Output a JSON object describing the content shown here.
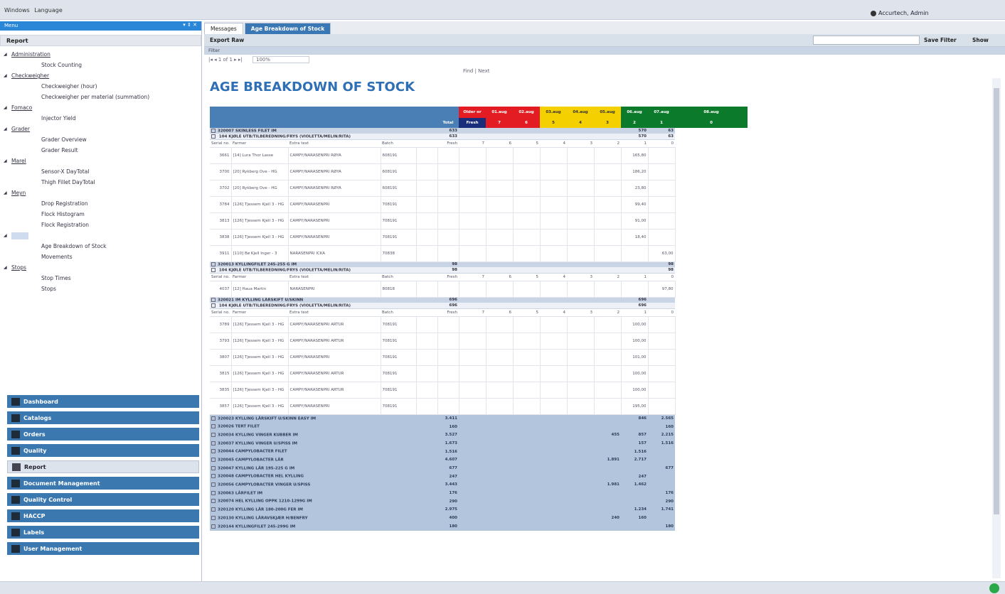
{
  "titlebar": {
    "menus": [
      "Windows",
      "Language"
    ],
    "user": "Accurtech, Admin"
  },
  "leftpanel": {
    "menu_title": "Menu",
    "menu_controls": "▾ ⇕ ✕",
    "report_header": "Report",
    "tree": [
      {
        "type": "group",
        "label": "Administration"
      },
      {
        "type": "leaf",
        "label": "Stock Counting"
      },
      {
        "type": "group",
        "label": "Checkweigher"
      },
      {
        "type": "leaf",
        "label": "Checkweigher (hour)"
      },
      {
        "type": "leaf",
        "label": "Checkweigher per material (summation)"
      },
      {
        "type": "group",
        "label": "Fomaco"
      },
      {
        "type": "leaf",
        "label": "Injector Yield"
      },
      {
        "type": "group",
        "label": "Grader"
      },
      {
        "type": "leaf",
        "label": "Grader Overview"
      },
      {
        "type": "leaf",
        "label": "Grader Result"
      },
      {
        "type": "group",
        "label": "Marel"
      },
      {
        "type": "leaf",
        "label": "Sensor-X DayTotal"
      },
      {
        "type": "leaf",
        "label": "Thigh Fillet DayTotal"
      },
      {
        "type": "group",
        "label": "Meyn"
      },
      {
        "type": "leaf",
        "label": "Drop Registration"
      },
      {
        "type": "leaf",
        "label": "Flock Histogram"
      },
      {
        "type": "leaf",
        "label": "Flock Registration"
      },
      {
        "type": "group",
        "label": "",
        "selected": true
      },
      {
        "type": "leaf",
        "label": "Age Breakdown of Stock"
      },
      {
        "type": "leaf",
        "label": "Movements"
      },
      {
        "type": "group",
        "label": "Stops"
      },
      {
        "type": "leaf",
        "label": "Stop Times"
      },
      {
        "type": "leaf",
        "label": "Stops"
      }
    ],
    "nav_buttons": [
      "Dashboard",
      "Catalogs",
      "Orders",
      "Quality",
      "Report",
      "Document Management",
      "Quality Control",
      "HACCP",
      "Labels",
      "User Management"
    ]
  },
  "rightpanel": {
    "tabs": [
      "Messages",
      "Age Breakdown of Stock"
    ],
    "toolbar": {
      "export": "Export Raw",
      "save_filter": "Save Filter",
      "show": "Show"
    },
    "filter_label": "Filter",
    "report_tools": {
      "nav": "|◂ ◂ 1  of 1 ▸ ▸|",
      "zoom": "100%",
      "find": "Find | Next"
    },
    "report_title": "AGE BREAKDOWN OF STOCK",
    "columns": {
      "total": "Total",
      "older": "Older or",
      "fresh": "Fresh",
      "dates": [
        "01.aug",
        "02.aug",
        "03.aug",
        "04.aug",
        "05.aug",
        "06.aug",
        "07.aug",
        "08.aug"
      ],
      "days": [
        "7",
        "6",
        "5",
        "4",
        "3",
        "2",
        "1",
        "0"
      ],
      "date_colors": [
        "red",
        "red",
        "ylw",
        "ylw",
        "ylw",
        "grn",
        "grn",
        "grn"
      ]
    },
    "subheaders": [
      "Serial no.",
      "Farmer",
      "Extra text",
      "Batch",
      "Fresh",
      "7",
      "6",
      "5",
      "4",
      "3",
      "2",
      "1",
      "0"
    ],
    "groups": [
      {
        "code": "320007",
        "name": "SKINLESS FILET IM",
        "total": "633",
        "d1": "570",
        "d0": "63",
        "product": "104 KJØLE UTB/TILBEREDNING/FRYS (VIOLETTA/MELIN/RITA)",
        "ptotal": "633",
        "pd1": "570",
        "pd0": "63",
        "rows": [
          {
            "serial": "3661",
            "farmer": "[14] Lura Thor Lasse",
            "extra": "CAMPY/NARASENPRI RØYA",
            "batch": "608191",
            "d1": "165,80",
            "d0": ""
          },
          {
            "serial": "3700",
            "farmer": "[20] Rykberg Ove - HG",
            "extra": "CAMPY/NARASENPRI RØYA",
            "batch": "608191",
            "d1": "186,20",
            "d0": ""
          },
          {
            "serial": "3702",
            "farmer": "[20] Rykberg Ove - HG",
            "extra": "CAMPY/NARASENPRI RØYA",
            "batch": "608191",
            "d1": "23,80",
            "d0": ""
          },
          {
            "serial": "3784",
            "farmer": "[126] Tjessem Kjell 3 - HG",
            "extra": "CAMPY/NARASENPRI",
            "batch": "708191",
            "d1": "99,40",
            "d0": ""
          },
          {
            "serial": "3813",
            "farmer": "[126] Tjessem Kjell 3 - HG",
            "extra": "CAMPY/NARASENPRI",
            "batch": "708191",
            "d1": "91,00",
            "d0": ""
          },
          {
            "serial": "3838",
            "farmer": "[126] Tjessem Kjell 3 - HG",
            "extra": "CAMPY/NARASENPRI",
            "batch": "708191",
            "d1": "18,40",
            "d0": ""
          },
          {
            "serial": "3911",
            "farmer": "[110] Bø Kjell Inger - 3",
            "extra": "NARASENPRI ICKA",
            "batch": "70838",
            "d1": "",
            "d0": "63,00"
          }
        ]
      },
      {
        "code": "320013",
        "name": "KYLLINGFILET 245-255 G IM",
        "total": "98",
        "d1": "",
        "d0": "98",
        "product": "104 KJØLE UTB/TILBEREDNING/FRYS (VIOLETTA/MELIN/RITA)",
        "ptotal": "98",
        "pd1": "",
        "pd0": "98",
        "rows": [
          {
            "serial": "4037",
            "farmer": "[12] Haua Martin",
            "extra": "NARASENPRI",
            "batch": "80818",
            "d1": "",
            "d0": "97,80"
          }
        ]
      },
      {
        "code": "320021",
        "name": "IM KYLLING LÅRSKIFT U/SKINN",
        "total": "696",
        "d1": "696",
        "d0": "",
        "product": "104 KJØLE UTB/TILBEREDNING/FRYS (VIOLETTA/MELIN/RITA)",
        "ptotal": "696",
        "pd1": "696",
        "pd0": "",
        "rows": [
          {
            "serial": "3789",
            "farmer": "[126] Tjessem Kjell 3 - HG",
            "extra": "CAMPY/NARASENPRI ARTUR",
            "batch": "708191",
            "d1": "100,00",
            "d0": ""
          },
          {
            "serial": "3793",
            "farmer": "[126] Tjessem Kjell 3 - HG",
            "extra": "CAMPY/NARASENPRI ARTUR",
            "batch": "708191",
            "d1": "100,00",
            "d0": ""
          },
          {
            "serial": "3807",
            "farmer": "[126] Tjessem Kjell 3 - HG",
            "extra": "CAMPY/NARASENPRI",
            "batch": "708191",
            "d1": "101,00",
            "d0": ""
          },
          {
            "serial": "3815",
            "farmer": "[126] Tjessem Kjell 3 - HG",
            "extra": "CAMPY/NARASENPRI ARTUR",
            "batch": "708191",
            "d1": "100,00",
            "d0": ""
          },
          {
            "serial": "3835",
            "farmer": "[126] Tjessem Kjell 3 - HG",
            "extra": "CAMPY/NARASENPRI ARTUR",
            "batch": "708191",
            "d1": "100,00",
            "d0": ""
          },
          {
            "serial": "3857",
            "farmer": "[126] Tjessem Kjell 3 - HG",
            "extra": "CAMPY/NARASENPRI",
            "batch": "708191",
            "d1": "195,00",
            "d0": ""
          }
        ]
      }
    ],
    "summary_rows": [
      {
        "code": "320023",
        "name": "KYLLING LÅRSKIFT U/SKINN EASY IM",
        "total": "3.411",
        "d2": "",
        "d1": "846",
        "d0": "2.565"
      },
      {
        "code": "320026",
        "name": "TERT FILET",
        "total": "160",
        "d2": "",
        "d1": "",
        "d0": "160"
      },
      {
        "code": "320034",
        "name": "KYLLING VINGER KUBBER IM",
        "total": "3.527",
        "d2": "455",
        "d1": "857",
        "d0": "2.215"
      },
      {
        "code": "320037",
        "name": "KYLLING VINGER U/SPISS IM",
        "total": "1.673",
        "d2": "",
        "d1": "157",
        "d0": "1.516"
      },
      {
        "code": "320044",
        "name": "CAMPYLOBACTER FILET",
        "total": "1.516",
        "d2": "",
        "d1": "1.516",
        "d0": ""
      },
      {
        "code": "320045",
        "name": "CAMPYLOBACTER LÅR",
        "total": "4.607",
        "d2": "1.891",
        "d1": "2.717",
        "d0": ""
      },
      {
        "code": "320047",
        "name": "KYLLING LÅR 195-225 G IM",
        "total": "677",
        "d2": "",
        "d1": "",
        "d0": "677"
      },
      {
        "code": "320048",
        "name": "CAMPYLOBACTER HEL KYLLING",
        "total": "247",
        "d2": "",
        "d1": "247",
        "d0": ""
      },
      {
        "code": "320056",
        "name": "CAMPYLOBACTER VINGER U/SPISS",
        "total": "3.443",
        "d2": "1.981",
        "d1": "1.462",
        "d0": ""
      },
      {
        "code": "320063",
        "name": "LÅRFILET IM",
        "total": "176",
        "d2": "",
        "d1": "",
        "d0": "176"
      },
      {
        "code": "320074",
        "name": "HEL KYLLING OPPK 1210-1299G IM",
        "total": "290",
        "d2": "",
        "d1": "",
        "d0": "290"
      },
      {
        "code": "320120",
        "name": "KYLLING LÅR 180-200G FER IM",
        "total": "2.975",
        "d2": "",
        "d1": "1.234",
        "d0": "1.741"
      },
      {
        "code": "320130",
        "name": "KYLLING LÅRAVSKJÆR H/BENFRY",
        "total": "400",
        "d2": "240",
        "d1": "160",
        "d0": ""
      },
      {
        "code": "320144",
        "name": "KYLLINGFILET 245-299G IM",
        "total": "180",
        "d2": "",
        "d1": "",
        "d0": "180"
      }
    ]
  }
}
